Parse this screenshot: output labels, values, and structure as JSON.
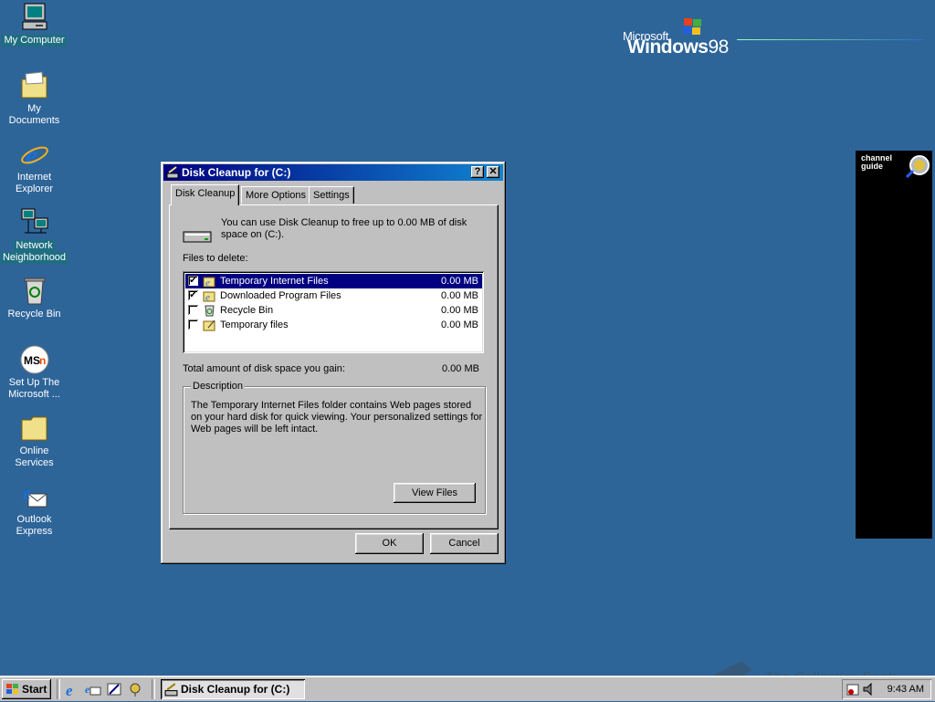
{
  "desktop": {
    "icons": [
      {
        "label_line1": "My Computer",
        "label_line2": ""
      },
      {
        "label_line1": "My Documents",
        "label_line2": ""
      },
      {
        "label_line1": "Internet",
        "label_line2": "Explorer"
      },
      {
        "label_line1": "Network",
        "label_line2": "Neighborhood"
      },
      {
        "label_line1": "Recycle Bin",
        "label_line2": ""
      },
      {
        "label_line1": "Set Up The",
        "label_line2": "Microsoft ..."
      },
      {
        "label_line1": "Online",
        "label_line2": "Services"
      },
      {
        "label_line1": "Outlook",
        "label_line2": "Express"
      }
    ],
    "logo": {
      "microsoft": "Microsoft",
      "windows": "Windows",
      "version": "98"
    },
    "channel_guide": {
      "line1": "channel",
      "line2": "guide"
    },
    "watermark": "The Collection Book"
  },
  "dialog": {
    "title": "Disk Cleanup for  (C:)",
    "help_button": "?",
    "close_button": "✕",
    "tabs": [
      {
        "label": "Disk Cleanup"
      },
      {
        "label": "More Options"
      },
      {
        "label": "Settings"
      }
    ],
    "intro_line1": "You can use Disk Cleanup to free up to 0.00 MB of disk",
    "intro_line2": "space on  (C:).",
    "files_label": "Files to delete:",
    "files": [
      {
        "name": "Temporary Internet Files",
        "size": "0.00 MB",
        "checked": true,
        "mark": "✔"
      },
      {
        "name": "Downloaded Program Files",
        "size": "0.00 MB",
        "checked": true,
        "mark": "✔"
      },
      {
        "name": "Recycle Bin",
        "size": "0.00 MB",
        "checked": false,
        "mark": ""
      },
      {
        "name": "Temporary files",
        "size": "0.00 MB",
        "checked": false,
        "mark": ""
      }
    ],
    "total_label": "Total amount of disk space you gain:",
    "total_value": "0.00 MB",
    "description_legend": "Description",
    "description_line1": "The Temporary Internet Files folder contains Web pages stored",
    "description_line2": "on your hard disk for quick viewing. Your personalized settings for",
    "description_line3": "Web pages will be left intact.",
    "view_files": "View Files",
    "ok": "OK",
    "cancel": "Cancel"
  },
  "taskbar": {
    "start": "Start",
    "task_button": "Disk Cleanup for  (C:)",
    "clock": "9:43 AM"
  },
  "colors": {
    "desktop": "#2e6599",
    "title_active": "#000080",
    "face": "#c0c0c0"
  }
}
